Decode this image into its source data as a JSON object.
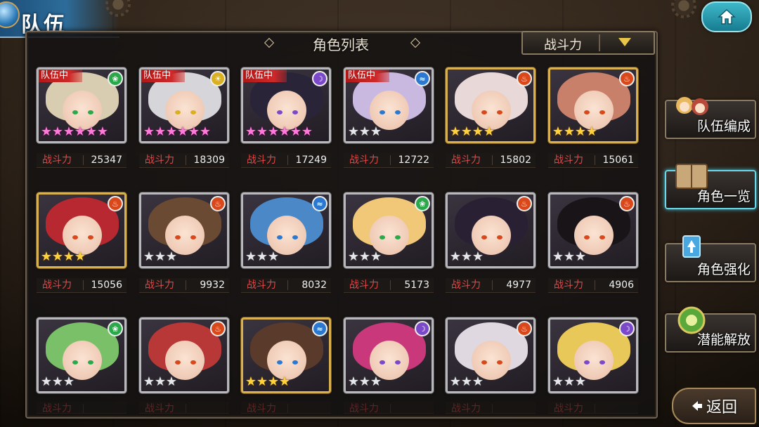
{
  "header": {
    "title": "队伍"
  },
  "panel": {
    "title": "角色列表"
  },
  "sort": {
    "label": "战斗力"
  },
  "power_label": "战斗力",
  "in_party_label": "队伍中",
  "side_menu": [
    {
      "label": "队伍编成",
      "icon": "party-icon",
      "active": false
    },
    {
      "label": "角色一览",
      "icon": "book-icon",
      "active": true
    },
    {
      "label": "角色强化",
      "icon": "enhance-icon",
      "active": false
    },
    {
      "label": "潜能解放",
      "icon": "potential-icon",
      "active": false
    }
  ],
  "back_label": "返回",
  "characters": [
    {
      "element": "wind",
      "in_party": true,
      "stars": 6,
      "star_color": "rainbow",
      "frame": "silver",
      "power": "25347",
      "hair": "#d8cdb0"
    },
    {
      "element": "light",
      "in_party": true,
      "stars": 6,
      "star_color": "rainbow",
      "frame": "silver",
      "power": "18309",
      "hair": "#d6d6da"
    },
    {
      "element": "dark",
      "in_party": true,
      "stars": 6,
      "star_color": "rainbow",
      "frame": "silver",
      "power": "17249",
      "hair": "#2a2438"
    },
    {
      "element": "water",
      "in_party": true,
      "stars": 3,
      "star_color": "silver",
      "frame": "silver",
      "power": "12722",
      "hair": "#c9b8e0"
    },
    {
      "element": "fire",
      "in_party": false,
      "stars": 4,
      "star_color": "gold",
      "frame": "gold",
      "power": "15802",
      "hair": "#e8d8d8"
    },
    {
      "element": "fire",
      "in_party": false,
      "stars": 4,
      "star_color": "gold",
      "frame": "gold",
      "power": "15061",
      "hair": "#c9806a"
    },
    {
      "element": "fire",
      "in_party": false,
      "stars": 4,
      "star_color": "gold",
      "frame": "gold",
      "power": "15056",
      "hair": "#b82830"
    },
    {
      "element": "fire",
      "in_party": false,
      "stars": 3,
      "star_color": "silver",
      "frame": "silver",
      "power": "9932",
      "hair": "#6a4a32"
    },
    {
      "element": "water",
      "in_party": false,
      "stars": 3,
      "star_color": "silver",
      "frame": "silver",
      "power": "8032",
      "hair": "#4a88c8"
    },
    {
      "element": "wind",
      "in_party": false,
      "stars": 3,
      "star_color": "silver",
      "frame": "silver",
      "power": "5173",
      "hair": "#f0c878"
    },
    {
      "element": "fire",
      "in_party": false,
      "stars": 3,
      "star_color": "silver",
      "frame": "silver",
      "power": "4977",
      "hair": "#2a2034"
    },
    {
      "element": "fire",
      "in_party": false,
      "stars": 3,
      "star_color": "silver",
      "frame": "silver",
      "power": "4906",
      "hair": "#181418"
    },
    {
      "element": "wind",
      "in_party": false,
      "stars": 3,
      "star_color": "silver",
      "frame": "silver",
      "power": "",
      "hair": "#7ac068"
    },
    {
      "element": "fire",
      "in_party": false,
      "stars": 3,
      "star_color": "silver",
      "frame": "silver",
      "power": "",
      "hair": "#b83838"
    },
    {
      "element": "water",
      "in_party": false,
      "stars": 4,
      "star_color": "gold",
      "frame": "gold",
      "power": "",
      "hair": "#5a3a2a"
    },
    {
      "element": "dark",
      "in_party": false,
      "stars": 3,
      "star_color": "silver",
      "frame": "silver",
      "power": "",
      "hair": "#c8387a"
    },
    {
      "element": "fire",
      "in_party": false,
      "stars": 3,
      "star_color": "silver",
      "frame": "silver",
      "power": "",
      "hair": "#e0d8e0"
    },
    {
      "element": "dark",
      "in_party": false,
      "stars": 3,
      "star_color": "silver",
      "frame": "silver",
      "power": "",
      "hair": "#e8c858"
    }
  ],
  "element_colors": {
    "wind": "#2aa84a",
    "light": "#d8b020",
    "dark": "#7a48c8",
    "water": "#2a78d0",
    "fire": "#d8481a"
  }
}
